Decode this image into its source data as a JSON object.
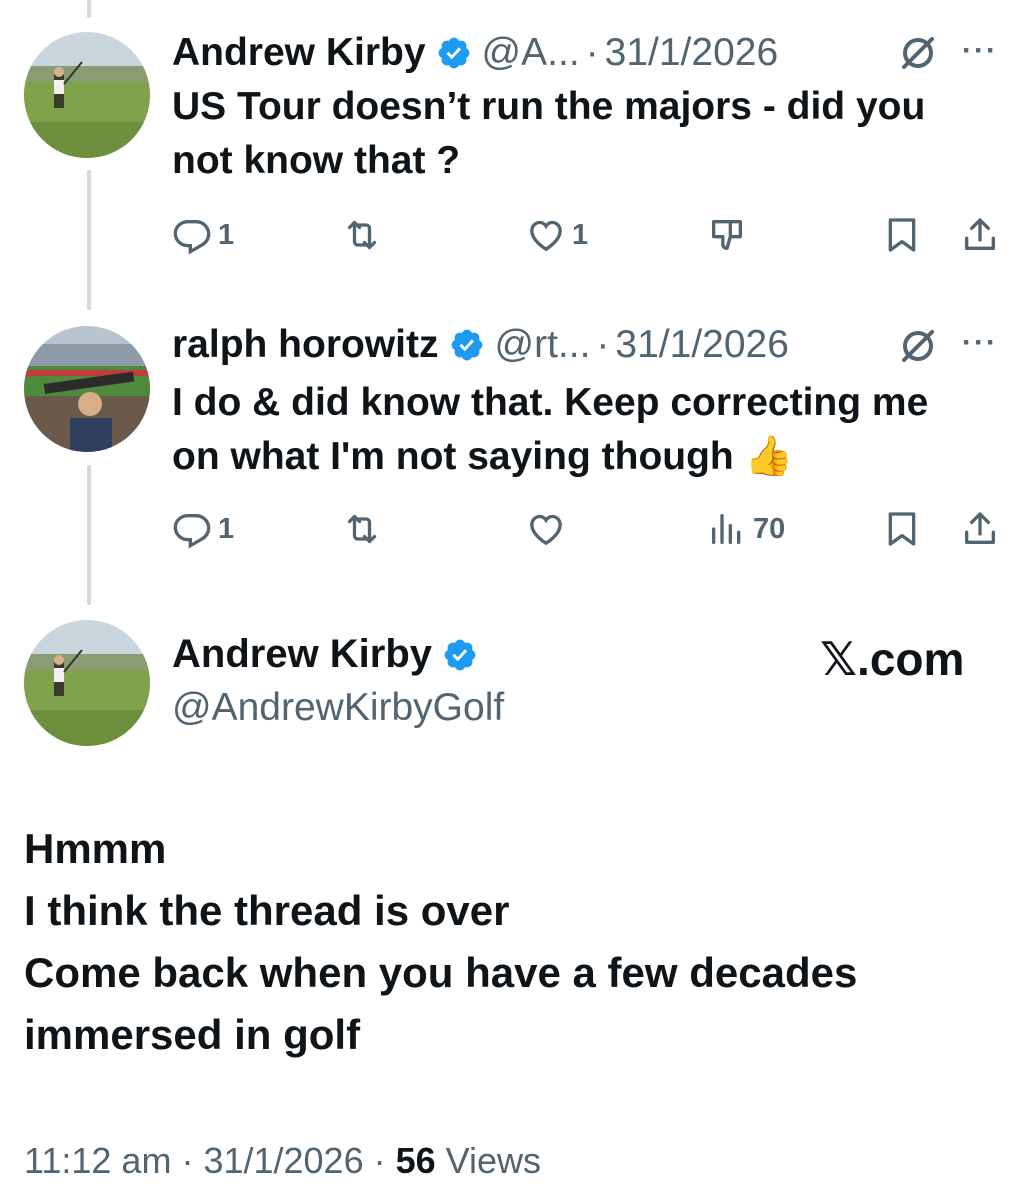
{
  "colors": {
    "accent": "#1d9bf0",
    "secondary_text": "#536471",
    "thread_line": "#cfd9de"
  },
  "reply1": {
    "author": "Andrew Kirby",
    "handle": "@A...",
    "sep": "·",
    "date": "31/1/2026",
    "more": "···",
    "text": "US Tour doesn’t run the majors - did you  not know that ?",
    "actions": {
      "replies": "1",
      "reposts": "",
      "likes": "1"
    },
    "icons": [
      "reply-icon",
      "repost-icon",
      "like-icon",
      "dislike-icon",
      "bookmark-icon",
      "share-icon"
    ]
  },
  "reply2": {
    "author": "ralph horowitz",
    "handle": "@rt...",
    "sep": "·",
    "date": "31/1/2026",
    "more": "···",
    "text": "I do & did know that. Keep correcting me on what I'm not saying though 👍",
    "actions": {
      "replies": "1",
      "reposts": "",
      "likes": "",
      "views": "70"
    },
    "icons": [
      "reply-icon",
      "repost-icon",
      "like-icon",
      "views-icon",
      "bookmark-icon",
      "share-icon"
    ]
  },
  "main_tweet": {
    "author": "Andrew Kirby",
    "handle": "@AndrewKirbyGolf",
    "watermark": "𝕏.com",
    "lines": [
      "Hmmm",
      "I think the thread is over",
      "Come back when you have a few decades",
      "immersed in golf"
    ],
    "time": "11:12 am",
    "sep1": " · ",
    "date": "31/1/2026",
    "sep2": " · ",
    "views_count": "56",
    "views_label": " Views"
  }
}
